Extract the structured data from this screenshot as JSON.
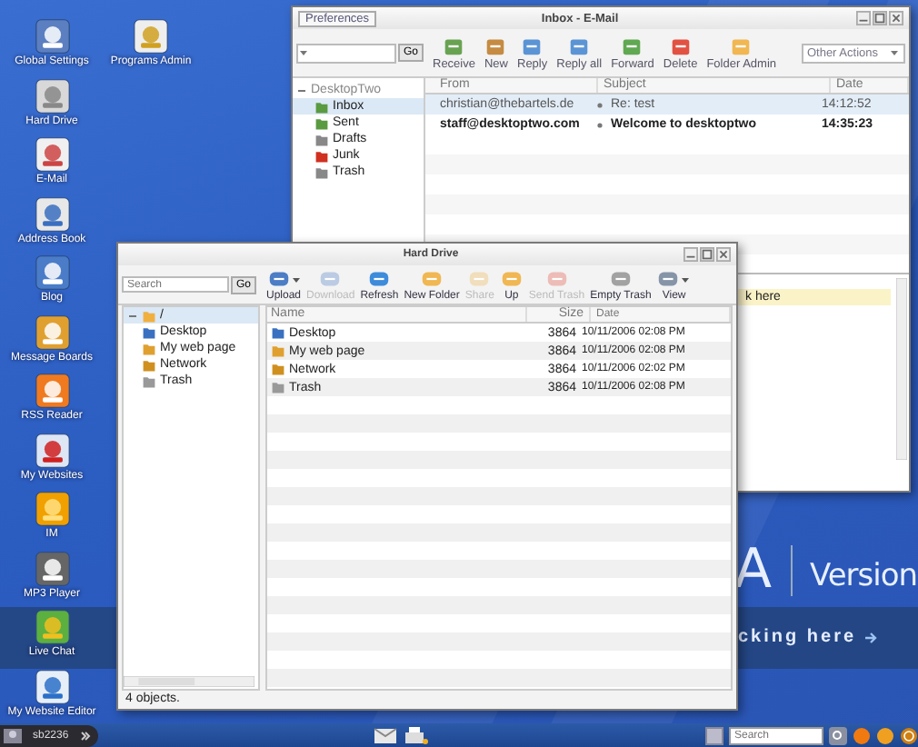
{
  "desktop": {
    "columns": [
      [
        {
          "label": "Global Settings"
        },
        {
          "label": "Hard Drive"
        },
        {
          "label": "E-Mail"
        },
        {
          "label": "Address Book"
        },
        {
          "label": "Blog"
        },
        {
          "label": "Message Boards"
        },
        {
          "label": "RSS Reader"
        },
        {
          "label": "My Websites"
        },
        {
          "label": "IM"
        },
        {
          "label": "MP3 Player"
        },
        {
          "label": "Live Chat"
        },
        {
          "label": "My Website Editor"
        }
      ],
      [
        {
          "label": "Programs Admin"
        }
      ]
    ]
  },
  "wallpaper": {
    "logo_tail": "A",
    "edition": "Version",
    "banner": "cking here"
  },
  "mail_window": {
    "title": "Inbox - E-Mail",
    "preferences": "Preferences",
    "search_button": "Go",
    "toolbar": [
      {
        "label": "Receive",
        "disabled": false
      },
      {
        "label": "New",
        "disabled": false
      },
      {
        "label": "Reply",
        "disabled": false
      },
      {
        "label": "Reply all",
        "disabled": false
      },
      {
        "label": "Forward",
        "disabled": false
      },
      {
        "label": "Delete",
        "disabled": false
      },
      {
        "label": "Folder Admin",
        "disabled": false
      }
    ],
    "other_actions": "Other Actions",
    "folders": {
      "label": "DesktopTwo",
      "expanded": true,
      "children": [
        {
          "label": "Inbox",
          "selected": true
        },
        {
          "label": "Sent",
          "selected": false
        },
        {
          "label": "Drafts",
          "selected": false
        },
        {
          "label": "Junk",
          "selected": false
        },
        {
          "label": "Trash",
          "selected": false
        }
      ]
    },
    "columns": [
      "From",
      "Subject",
      "Date"
    ],
    "messages": [
      {
        "from": "christian@thebartels.de",
        "subject": "Re: test",
        "date": "14:12:52",
        "unread": false,
        "selected": true
      },
      {
        "from": "staff@desktoptwo.com",
        "subject": "Welcome to desktoptwo",
        "date": "14:35:23",
        "unread": true,
        "selected": false
      }
    ],
    "preview_banner": "k here"
  },
  "drive_window": {
    "title": "Hard Drive",
    "search_placeholder": "Search",
    "search_button": "Go",
    "toolbar": [
      {
        "label": "Upload",
        "disabled": false,
        "menu": true
      },
      {
        "label": "Download",
        "disabled": true,
        "menu": false
      },
      {
        "label": "Refresh",
        "disabled": false,
        "menu": false
      },
      {
        "label": "New Folder",
        "disabled": false,
        "menu": false
      },
      {
        "label": "Share",
        "disabled": true,
        "menu": false
      },
      {
        "label": "Up",
        "disabled": false,
        "menu": false
      },
      {
        "label": "Send Trash",
        "disabled": true,
        "menu": false
      },
      {
        "label": "Empty Trash",
        "disabled": false,
        "menu": false
      },
      {
        "label": "View",
        "disabled": false,
        "menu": true
      }
    ],
    "tree": {
      "label": "/",
      "expanded": true,
      "selected": true,
      "children": [
        {
          "label": "Desktop",
          "selected": false
        },
        {
          "label": "My web page",
          "selected": false
        },
        {
          "label": "Network",
          "selected": false
        },
        {
          "label": "Trash",
          "selected": false
        }
      ]
    },
    "columns": [
      "Name",
      "Size",
      "Date"
    ],
    "files": [
      {
        "name": "Desktop",
        "size": "3864",
        "date": "10/11/2006 02:08 PM"
      },
      {
        "name": "My web page",
        "size": "3864",
        "date": "10/11/2006 02:08 PM"
      },
      {
        "name": "Network",
        "size": "3864",
        "date": "10/11/2006 02:02 PM"
      },
      {
        "name": "Trash",
        "size": "3864",
        "date": "10/11/2006 02:08 PM"
      }
    ],
    "status": "4 objects."
  },
  "taskbar": {
    "user": "sb2236",
    "search_placeholder": "Search"
  }
}
